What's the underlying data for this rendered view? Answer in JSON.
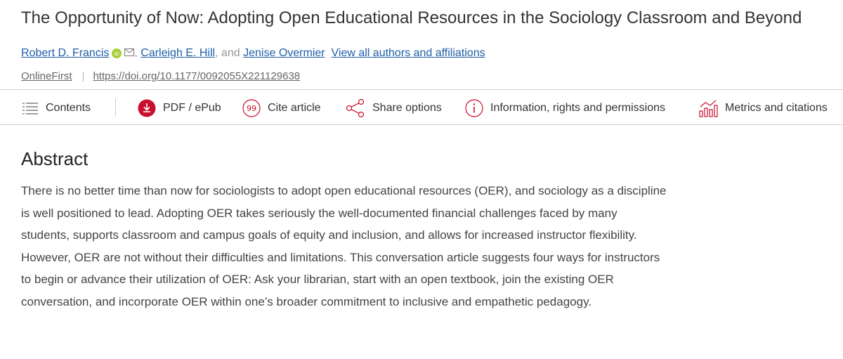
{
  "article": {
    "title": "The Opportunity of Now: Adopting Open Educational Resources in the Sociology Classroom and Beyond"
  },
  "authors": {
    "author1": "Robert D. Francis",
    "author2": "Carleigh E. Hill",
    "conjunction": "and",
    "author3": "Jenise Overmier",
    "view_all": "View all authors and affiliations"
  },
  "publication": {
    "status": "OnlineFirst",
    "separator": "|",
    "doi": "https://doi.org/10.1177/0092055X221129638"
  },
  "toolbar": {
    "contents": "Contents",
    "pdf": "PDF / ePub",
    "cite": "Cite article",
    "share": "Share options",
    "info": "Information, rights and permissions",
    "metrics": "Metrics and citations"
  },
  "abstract": {
    "heading": "Abstract",
    "text": "There is no better time than now for sociologists to adopt open educational resources (OER), and sociology as a discipline is well positioned to lead. Adopting OER takes seriously the well-documented financial challenges faced by many students, supports classroom and campus goals of equity and inclusion, and allows for increased instructor flexibility. However, OER are not without their difficulties and limitations. This conversation article suggests four ways for instructors to begin or advance their utilization of OER: Ask your librarian, start with an open textbook, join the existing OER conversation, and incorporate OER within one’s broader commitment to inclusive and empathetic pedagogy."
  },
  "icons": {
    "orcid": "orcid-icon",
    "mail": "mail-icon",
    "contents": "list-icon",
    "pdf": "download-icon",
    "cite": "quote-icon",
    "share": "share-icon",
    "info": "info-icon",
    "metrics": "bar-chart-icon"
  },
  "colors": {
    "link": "#1f5fa8",
    "accent": "#c8102e",
    "orcid": "#a6ce39"
  }
}
